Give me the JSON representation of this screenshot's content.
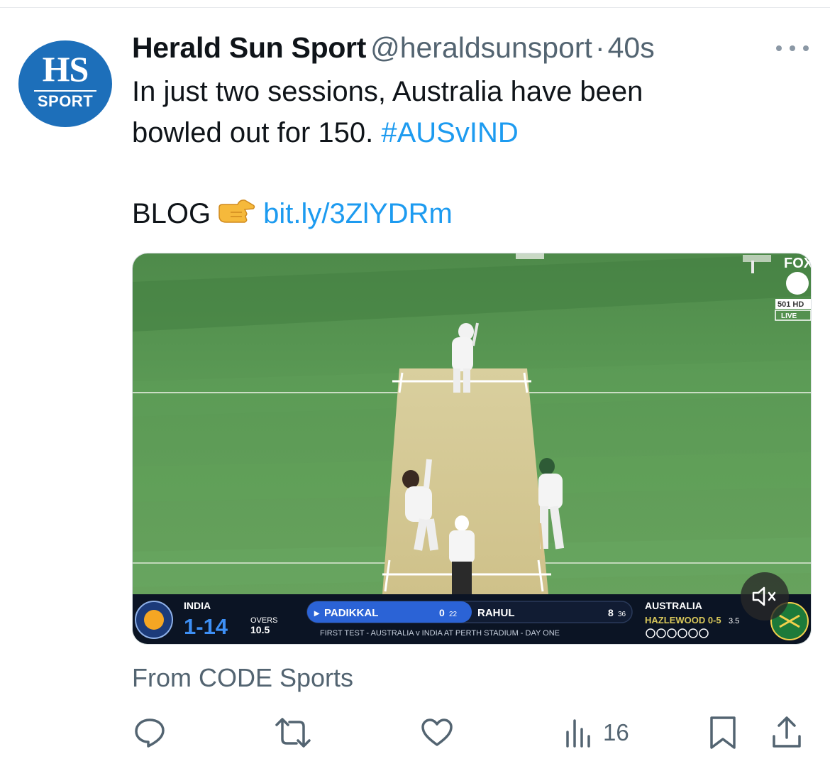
{
  "account": {
    "display_name": "Herald Sun Sport",
    "handle": "@heraldsunsport",
    "separator": "·",
    "timestamp": "40s",
    "avatar": {
      "initials": "HS",
      "sub": "SPORT",
      "bg_color": "#1d6fba"
    }
  },
  "tweet": {
    "line1": "In just two sessions, Australia have been",
    "line2_text": "bowled out for 150.",
    "hashtag": "#AUSvIND",
    "blog_label": "BLOG",
    "pointing_icon": "backhand-index-pointing-right-icon",
    "link": "bit.ly/3ZlYDRm"
  },
  "media": {
    "type": "video",
    "broadcaster_tag": "FOX",
    "channel": "501 HD",
    "live_label": "LIVE",
    "muted": true,
    "scoreboard": {
      "batting_team": "INDIA",
      "score": "1-14",
      "overs_label": "OVERS",
      "overs": "10.5",
      "batter1_name": "PADIKKAL",
      "batter1_runs": "0",
      "batter1_balls": "22",
      "batter2_name": "RAHUL",
      "batter2_runs": "8",
      "batter2_balls": "36",
      "bowling_team": "AUSTRALIA",
      "bowler": "HAZLEWOOD 0-5",
      "bowler_overs": "3.5",
      "match_info": "FIRST TEST - AUSTRALIA v INDIA AT PERTH STADIUM - DAY ONE"
    }
  },
  "source": "From CODE Sports",
  "actions": {
    "reply_icon": "reply-icon",
    "retweet_icon": "retweet-icon",
    "like_icon": "heart-icon",
    "views_icon": "views-icon",
    "views_count": "16",
    "bookmark_icon": "bookmark-icon",
    "share_icon": "share-icon"
  },
  "colors": {
    "link": "#1d9bf0",
    "secondary_text": "#536471",
    "primary_text": "#0f1419"
  }
}
